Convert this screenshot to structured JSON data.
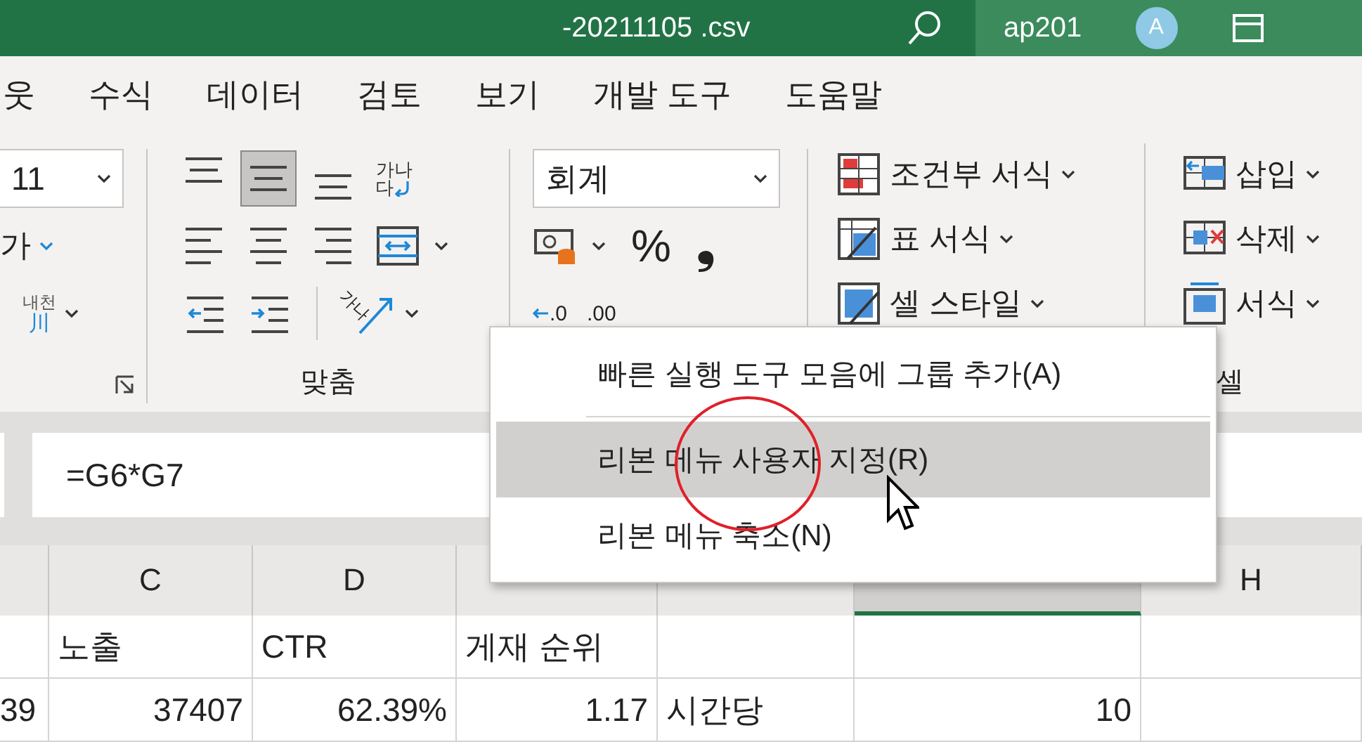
{
  "window": {
    "title": "-20211105 .csv",
    "user": "ap201",
    "avatar": "A"
  },
  "tabs": [
    {
      "label": "웃",
      "selected": false
    },
    {
      "label": "수식",
      "selected": false
    },
    {
      "label": "데이터",
      "selected": false
    },
    {
      "label": "검토",
      "selected": false
    },
    {
      "label": "보기",
      "selected": false
    },
    {
      "label": "개발 도구",
      "selected": false
    },
    {
      "label": "도움말",
      "selected": false
    }
  ],
  "ribbon": {
    "font_group": {
      "size": "11",
      "grow_glyph": "가",
      "phonetic_top": "내천",
      "phonetic_bottom": "川"
    },
    "alignment_group": {
      "label": "맞춤",
      "wrap_top": "가나",
      "wrap_bottom": "다",
      "orientation_text": "가나",
      "vertical_buttons": [
        {
          "kind": "top",
          "selected": false
        },
        {
          "kind": "middle",
          "selected": true
        },
        {
          "kind": "bottom",
          "selected": false
        }
      ]
    },
    "number_group": {
      "format": "회계",
      "percent": "%",
      "comma": "❟",
      "decimals": [
        ".0",
        ".00"
      ]
    },
    "styles_group": {
      "items": [
        {
          "kind": "conditional",
          "label": "조건부 서식"
        },
        {
          "kind": "table",
          "label": "표 서식"
        },
        {
          "kind": "cell",
          "label": "셀 스타일"
        }
      ]
    },
    "cells_group": {
      "label": "셀",
      "items": [
        {
          "kind": "insert",
          "label": "삽입"
        },
        {
          "kind": "delete",
          "label": "삭제"
        },
        {
          "kind": "format",
          "label": "서식"
        }
      ]
    }
  },
  "formula_bar": {
    "formula": "=G6*G7"
  },
  "grid": {
    "columns": [
      {
        "selected": false
      },
      {
        "label": "C",
        "selected": false
      },
      {
        "label": "D",
        "selected": false
      },
      {
        "selected": false
      },
      {
        "selected": false
      },
      {
        "selected": true
      },
      {
        "label": "H",
        "selected": false
      }
    ],
    "rows": [
      {
        "cells": [
          null,
          "노출",
          "CTR",
          "게재 순위",
          null,
          null,
          null
        ]
      },
      {
        "cells": [
          "39",
          "37407",
          "62.39%",
          "1.17",
          "시간당",
          "10",
          null
        ]
      }
    ]
  },
  "context_menu": {
    "items": [
      {
        "label": "빠른 실행 도구 모음에 그룹 추가(A)",
        "selected": false,
        "separator_after": true
      },
      {
        "label": "리본 메뉴 사용자 지정(R)",
        "selected": true,
        "separator_after": false
      },
      {
        "label": "리본 메뉴 축소(N)",
        "selected": false,
        "separator_after": false
      }
    ]
  }
}
